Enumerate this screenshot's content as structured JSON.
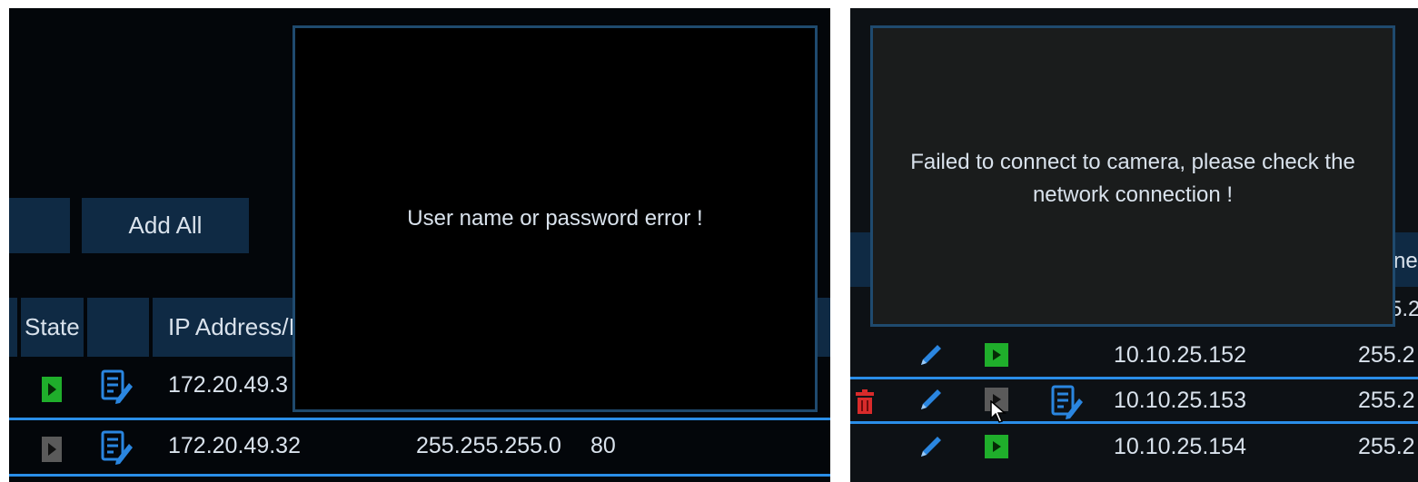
{
  "left": {
    "toolbar": {
      "add_all_label": "Add All"
    },
    "table": {
      "columns": {
        "state": "State",
        "ip": "IP Address/I"
      },
      "rows": [
        {
          "state": "online",
          "ip": "172.20.49.3",
          "mask": "",
          "port": ""
        },
        {
          "state": "offline",
          "ip": "172.20.49.32",
          "mask": "255.255.255.0",
          "port": "80"
        }
      ]
    },
    "dialog": {
      "message": "User name or password error !"
    }
  },
  "right": {
    "dialog": {
      "message_line1": "Failed to connect to camera, please check the",
      "message_line2": "network connection !"
    },
    "partial_header": "ne",
    "partial_value": "5.2",
    "rows": [
      {
        "state": "online",
        "ip": "10.10.25.152",
        "mask": "255.2"
      },
      {
        "state": "offline",
        "ip": "10.10.25.153",
        "mask": "255.2"
      },
      {
        "state": "online",
        "ip": "10.10.25.154",
        "mask": "255.2"
      }
    ]
  },
  "colors": {
    "button_bg": "#0f2a44",
    "selection": "#2a8ee8",
    "play_online": "#1fae2b",
    "play_offline": "#5a5a5a",
    "delete": "#d92b2b",
    "edit": "#2a86e0"
  }
}
